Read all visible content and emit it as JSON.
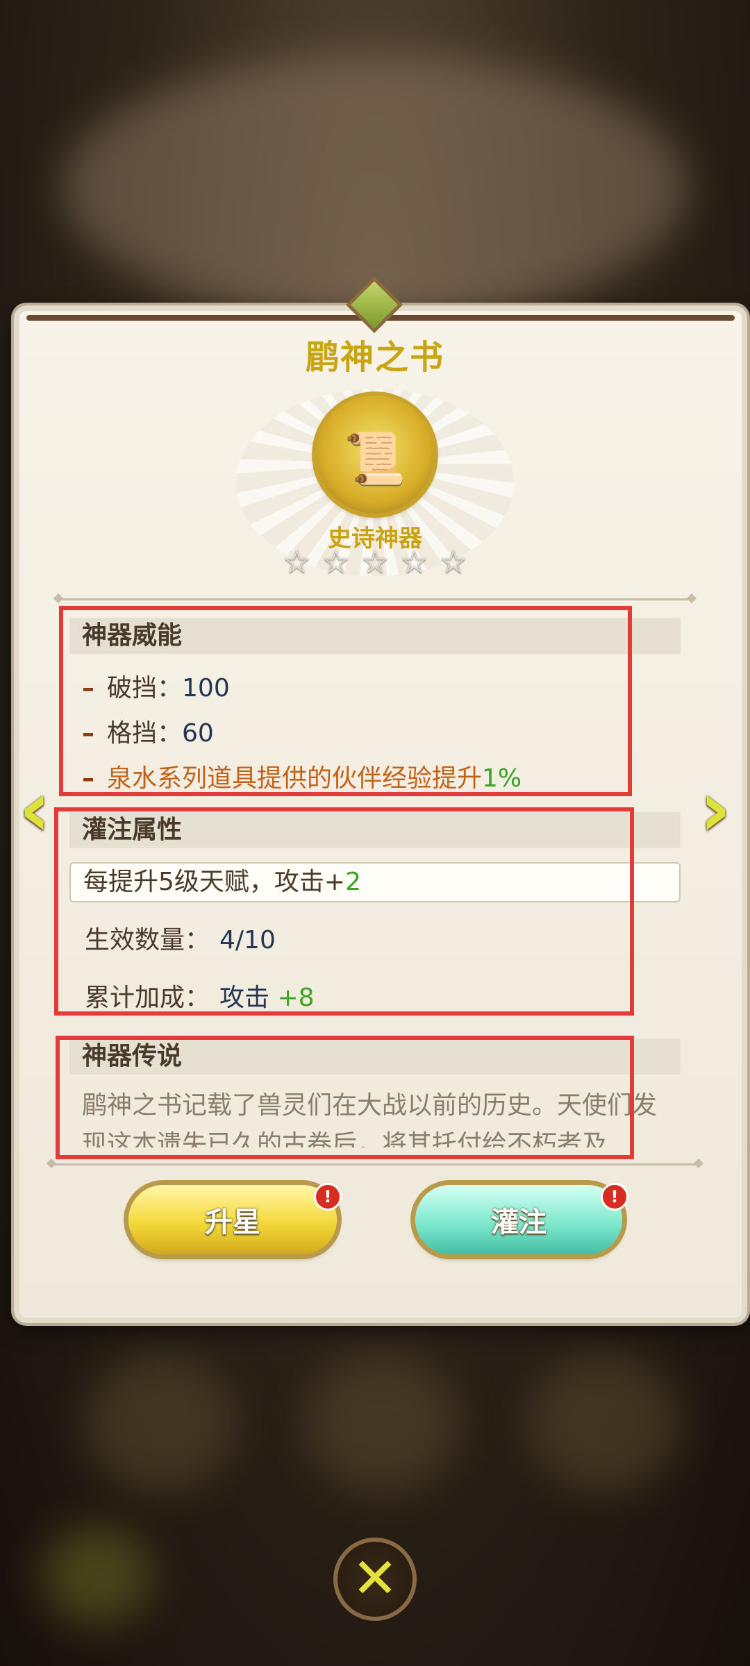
{
  "dialog": {
    "title": "鹛神之书",
    "rarity": "史诗神器",
    "stars": [
      "☆",
      "☆",
      "☆",
      "☆",
      "☆"
    ]
  },
  "power": {
    "header": "神器威能",
    "lines": [
      {
        "label": "破挡：",
        "value": "100"
      },
      {
        "label": "格挡：",
        "value": "60"
      }
    ],
    "bonus_text": "泉水系列道具提供的伙伴经验提升",
    "bonus_value": "1%"
  },
  "infuse": {
    "header": "灌注属性",
    "rule_text": "每提升5级天赋，攻击+",
    "rule_value": "2",
    "count_label": "生效数量：",
    "count_value": "4/10",
    "total_label": "累计加成：",
    "total_stat": "攻击",
    "total_value": "+8"
  },
  "lore": {
    "header": "神器传说",
    "text": "鹛神之书记载了兽灵们在大战以前的历史。天使们发现这本遗失已久的古卷后，将其托付给不朽者及"
  },
  "buttons": {
    "star_up": "升星",
    "infuse": "灌注",
    "badge": "!"
  },
  "icons": {
    "nav_left": "‹",
    "nav_right": "›",
    "close": "✕",
    "artifact": "📜"
  },
  "colors": {
    "title": "#c8a512",
    "highlight_red": "#e53a3a",
    "green_value": "#3aa321"
  }
}
